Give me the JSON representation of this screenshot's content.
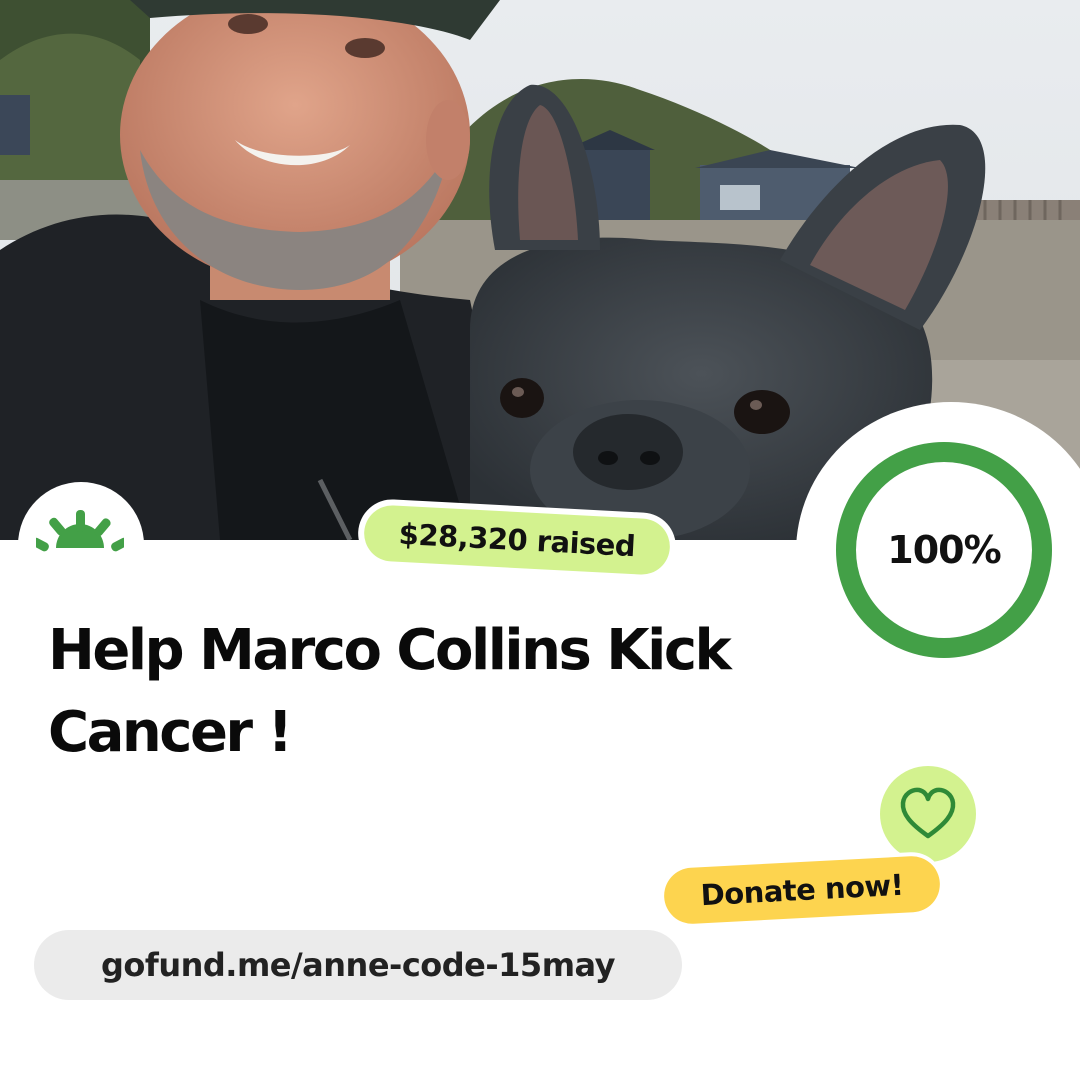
{
  "campaign": {
    "title": "Help Marco Collins Kick Cancer !",
    "raised_label": "$28,320 raised",
    "progress_label": "100%",
    "progress_fraction": 1.0,
    "donate_label": "Donate now!",
    "url": "gofund.me/anne-code-15may"
  },
  "photo": {
    "description_icon": "man-with-french-bulldog-photo"
  },
  "icons": {
    "logo": "gofundme-sun-logo-icon",
    "heart": "heart-icon"
  },
  "colors": {
    "brand_green": "#43a047",
    "lime": "#d3f28f",
    "yellow": "#fdd44f",
    "pill_gray": "#ebebeb",
    "text": "#0a0a0a"
  }
}
